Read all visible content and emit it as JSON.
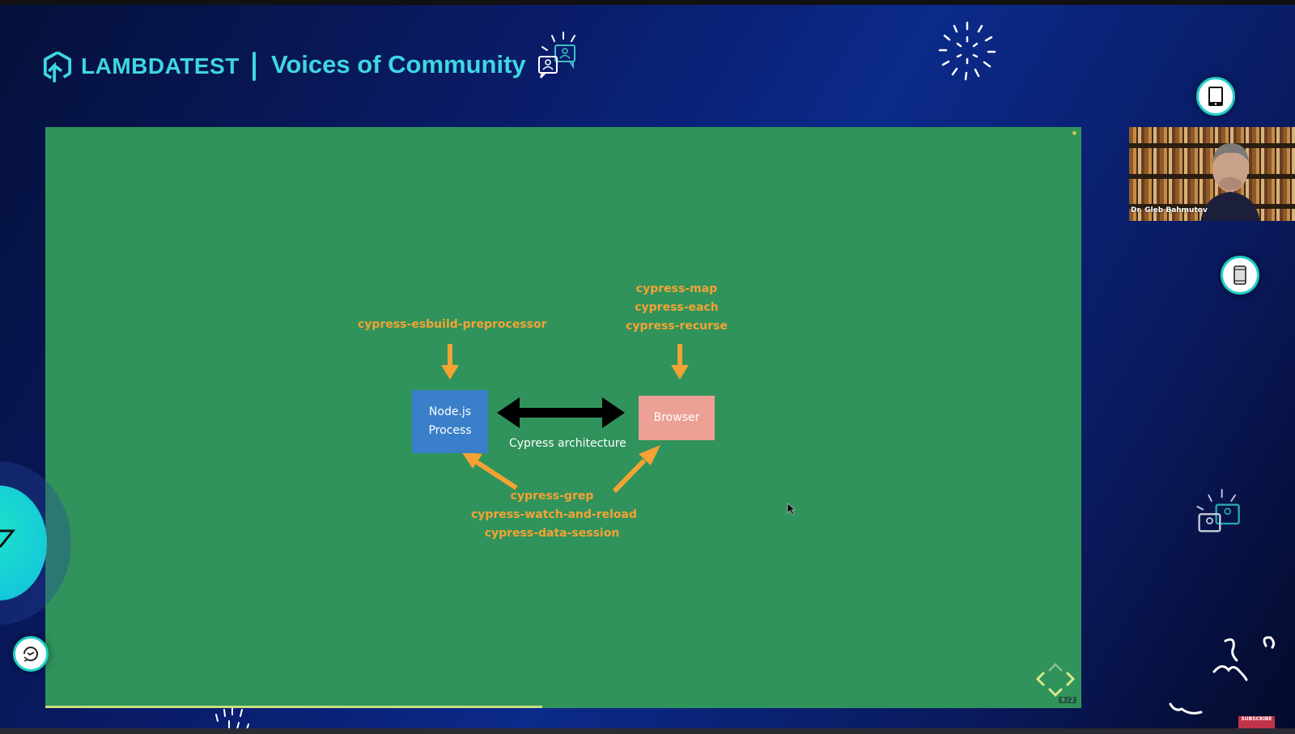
{
  "header": {
    "brand_name": "LAMBDATEST",
    "show_title": "Voices of Community"
  },
  "slide": {
    "title": "Cypress architecture",
    "node_box": {
      "line1": "Node.js",
      "line2": "Process"
    },
    "browser_box": {
      "label": "Browser"
    },
    "top_left_plugins": [
      "cypress-esbuild-preprocessor"
    ],
    "top_right_plugins": [
      "cypress-map",
      "cypress-each",
      "cypress-recurse"
    ],
    "bottom_plugins": [
      "cypress-grep",
      "cypress-watch-and-reload",
      "cypress-data-session"
    ],
    "progress_fraction": 0.48,
    "slide_number": "8 / 2",
    "colors": {
      "background": "#30935b",
      "node_box": "#3a7fc9",
      "browser_box": "#eda095",
      "plugin_text": "#f4a235",
      "arrow_orange": "#f4a235"
    }
  },
  "webcam": {
    "speaker_name": "Dr. Gleb Bahmutov"
  },
  "overlay": {
    "subscribe_label": "SUBSCRIBE"
  },
  "icons": {
    "tablet": "tablet-icon",
    "phone": "phone-icon",
    "clock": "clock-icon",
    "chat": "chat-bubbles-icon"
  }
}
